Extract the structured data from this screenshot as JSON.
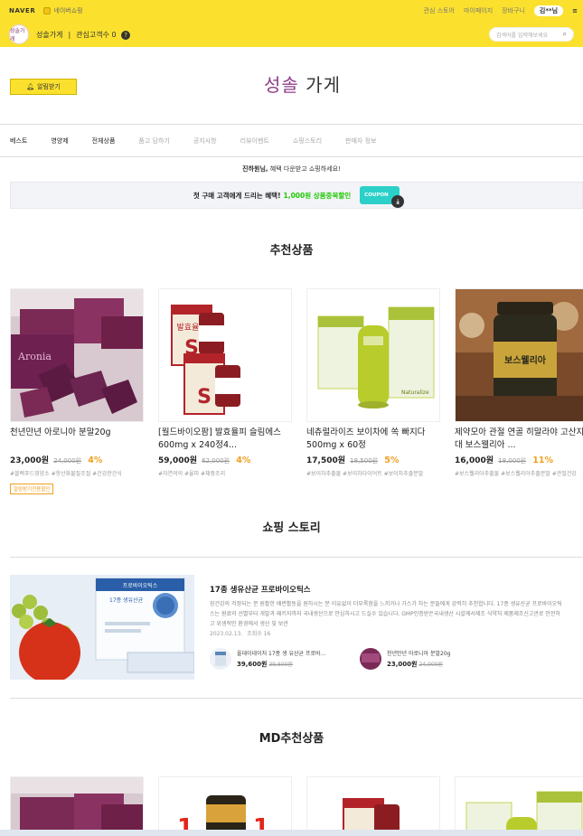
{
  "top_util": {
    "naver": "NAVER",
    "mini_store": "네이버쇼핑",
    "links": [
      "관심 스토어",
      "마이페이지",
      "장바구니"
    ],
    "user": "김**님",
    "more": "≡"
  },
  "store_bar": {
    "logo_text": "성솔가게",
    "store_name": "성솔가게",
    "separator": "|",
    "fav_label": "관심고객수 0",
    "fav_badge": "?",
    "search_placeholder": "검색어를 입력해보세요"
  },
  "header": {
    "alarm_label": "알림받기",
    "brand_part1": "성솔",
    "brand_part2": " 가게"
  },
  "nav": {
    "items": [
      {
        "label": "베스트",
        "dim": false
      },
      {
        "label": "영양제",
        "dim": false
      },
      {
        "label": "전체상품",
        "dim": false
      },
      {
        "label": "품고 담하기",
        "dim": true
      },
      {
        "label": "공지사항",
        "dim": true
      },
      {
        "label": "리뷰이벤트",
        "dim": true
      },
      {
        "label": "쇼핑스토리",
        "dim": true
      },
      {
        "label": "판매자 정보",
        "dim": true
      }
    ]
  },
  "welcome": {
    "name": "진하원님,",
    "text": " 혜택 다운받고 쇼핑하세요!"
  },
  "coupon": {
    "text": "첫 구매 고객에게 드리는 혜택!",
    "highlight": "1,000원 상품중복할인",
    "tag": "COUPON",
    "dl_icon": "⤓"
  },
  "sections": {
    "recommended": "추천상품",
    "story": "쇼핑 스토리",
    "md": "MD추천상품"
  },
  "products": [
    {
      "name": "천년만년 아로니아 분말20g",
      "price": "23,000원",
      "orig": "24,000원",
      "discount": "4%",
      "tags": "#블랙푸드영양소 #항산화물질조절 #건강한간식",
      "badge": "알림받기전용할인"
    },
    {
      "name": "[월드바이오팜] 발효율피 슬림에스 600mg x 240정4...",
      "price": "59,000원",
      "orig": "62,000원",
      "discount": "4%",
      "tags": "#자연의의 #율피 #체중조리",
      "badge": ""
    },
    {
      "name": "네츄럴라이즈 보이차에 쏙 빠지다 500mg x 60정",
      "price": "17,500원",
      "orig": "18,500원",
      "discount": "5%",
      "tags": "#보이차추출물 #보이차다이어트 #보이차추출분말",
      "badge": ""
    },
    {
      "name": "제약모아 관절 연골 히말라야 고산지대 보스웰리아 ...",
      "price": "16,000원",
      "orig": "18,000원",
      "discount": "11%",
      "tags": "#보스웰리아추출물 #보스웰리아추출분말 #관절건강",
      "badge": ""
    }
  ],
  "story": {
    "title": "17종 생유산균 프로바이오틱스",
    "desc": "장건강의 걱정되는 분 원활한 배변활동을 원하시는 분 이유없이 더부룩함을 느끼거나 가스가 차는 분들에게 강력히 추천합니다. 17종 생유산균 프로바이오틱스는 원료의 선별부터 개발과 패키지까지 국내생산으로 안심하시고 드실수 있습니다. GMP인증받은국내생산 시설에서제조 식약처 제품제조신고관로 안전하고 위생적인 환경에서 생산 및 보관",
    "date": "2023.02.13.",
    "views": "조회수 16",
    "image_caption": "프로바이오틱스",
    "box_text": "17종 생유산균",
    "related": [
      {
        "name": "올데이네이처 17종 생 유산균 프로바...",
        "price": "39,600원",
        "orig": "39,600원"
      },
      {
        "name": "천년만년 아로니아 분말20g",
        "price": "23,000원",
        "orig": "24,000원"
      }
    ]
  }
}
